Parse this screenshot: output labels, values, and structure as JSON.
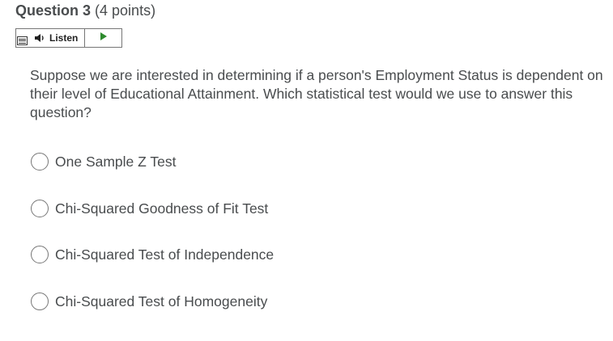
{
  "question": {
    "title": "Question 3",
    "points": "(4 points)",
    "text": "Suppose we are interested in determining if a person's Employment Status is dependent on their level of Educational Attainment. Which statistical test would we use to answer this question?"
  },
  "listen": {
    "label": "Listen",
    "menu_icon": "menu-icon",
    "speaker_icon": "speaker-icon",
    "play_icon": "play-icon",
    "play_color": "#2e8b2e"
  },
  "options": [
    {
      "label": "One Sample Z Test"
    },
    {
      "label": "Chi-Squared Goodness of Fit Test"
    },
    {
      "label": "Chi-Squared Test of Independence"
    },
    {
      "label": "Chi-Squared Test of Homogeneity"
    }
  ]
}
